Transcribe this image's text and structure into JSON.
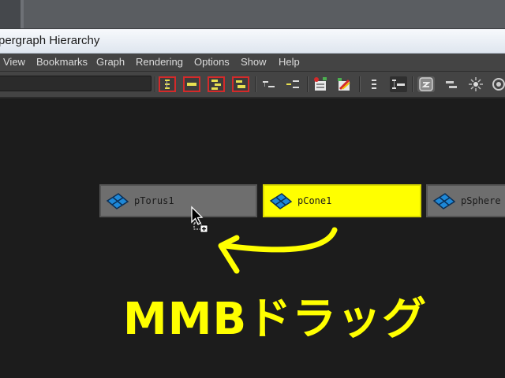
{
  "window": {
    "title": "pergraph Hierarchy"
  },
  "menu": {
    "items": [
      "View",
      "Bookmarks",
      "Graph",
      "Rendering",
      "Options",
      "Show",
      "Help"
    ]
  },
  "toolbar": {
    "search_value": "",
    "icons": [
      "scene-hierarchy-icon",
      "input-connections-icon",
      "output-connections-icon",
      "input-output-connections-icon",
      "collapse-hierarchy-icon",
      "expand-hierarchy-icon",
      "add-selected-icon",
      "graph-selected-icon",
      "list-layout-icon",
      "hierarchy-layout-icon",
      "freeform-icon",
      "node-display-icon",
      "lighting-icon",
      "shader-icon"
    ]
  },
  "nodes": [
    {
      "label": "pTorus1",
      "state": "normal",
      "icon": "mesh-icon"
    },
    {
      "label": "pCone1",
      "state": "selected",
      "icon": "mesh-icon"
    },
    {
      "label": "pSphere",
      "state": "normal",
      "icon": "mesh-icon"
    }
  ],
  "annotation": {
    "caption": "MMBドラッグ",
    "color": "#ffff00",
    "arrow_icon": "curved-arrow-icon"
  },
  "colors": {
    "selected_node": "#ffff00",
    "node": "#6e6e6e",
    "background": "#1c1c1c",
    "highlight_border": "#d42a2a"
  }
}
